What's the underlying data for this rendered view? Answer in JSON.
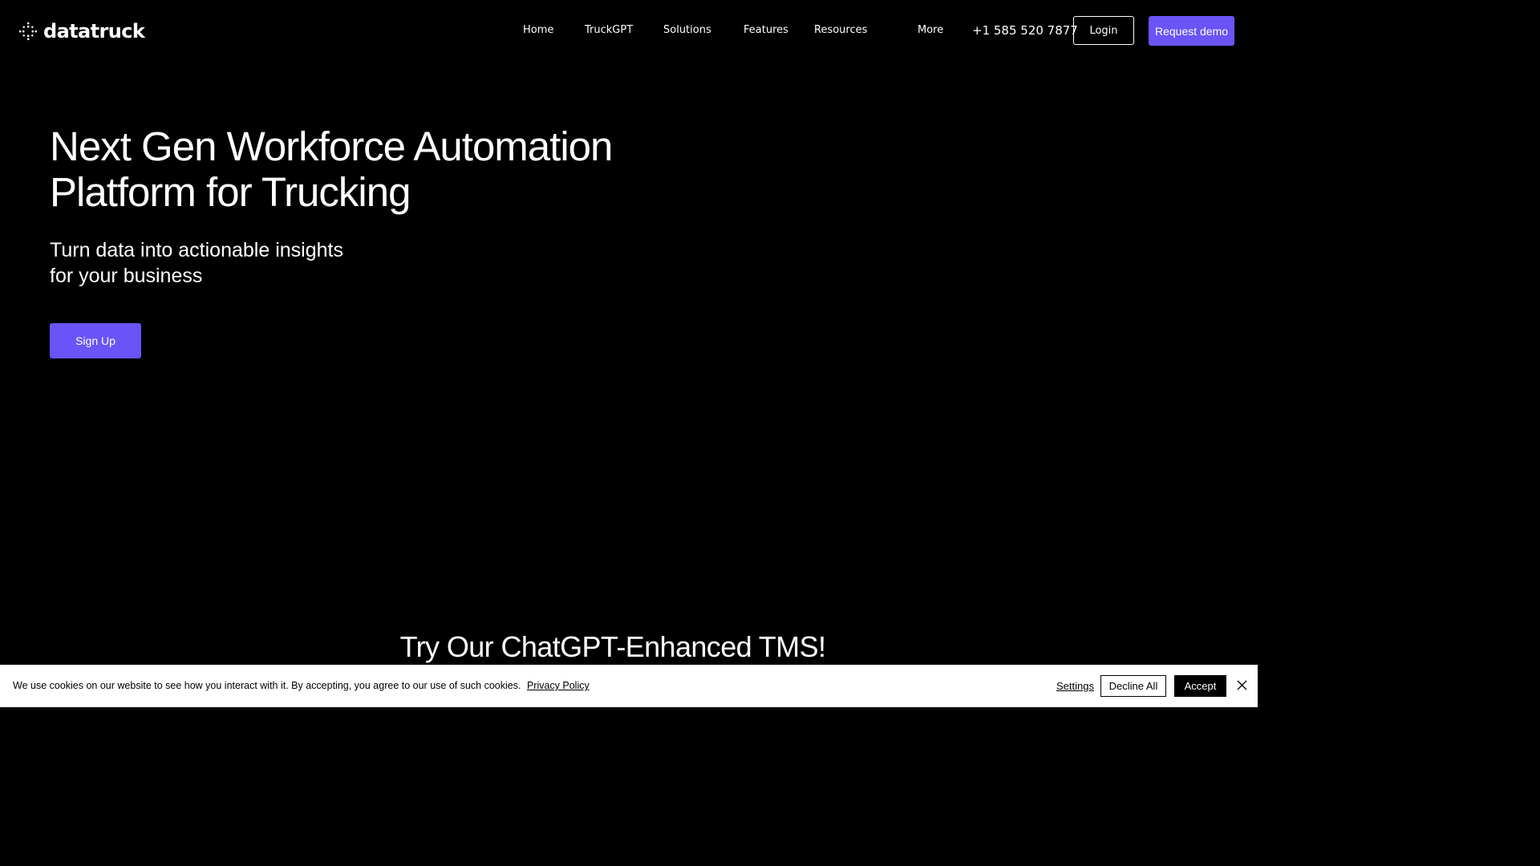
{
  "header": {
    "logo_text": "datatruck",
    "nav": [
      "Home",
      "TruckGPT",
      "Solutions",
      "Features",
      "Resources",
      "More"
    ],
    "phone": "+1 585 520 7877",
    "login_label": "Login",
    "demo_label": "Request demo"
  },
  "hero": {
    "title_line1": "Next Gen Workforce Automation",
    "title_line2": "Platform for Trucking",
    "subtitle_line1": "Turn data into actionable insights",
    "subtitle_line2": "for your business",
    "signup_label": "Sign Up"
  },
  "section": {
    "title": "Try Our ChatGPT-Enhanced TMS!"
  },
  "cookie": {
    "text": "We use cookies on our website to see how you interact with it. By accepting, you agree to our use of such cookies.",
    "privacy_link": "Privacy Policy",
    "settings_label": "Settings",
    "decline_label": "Decline All",
    "accept_label": "Accept"
  },
  "colors": {
    "accent": "#6a54f7",
    "background": "#000000",
    "cookie_background": "#ffffff"
  },
  "icons": {
    "logo": "sparkle-dots-icon",
    "close": "close-icon"
  }
}
